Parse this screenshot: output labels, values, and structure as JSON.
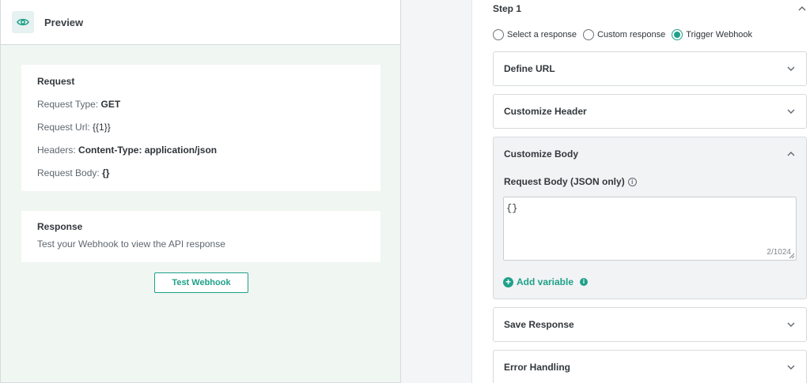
{
  "preview": {
    "title": "Preview",
    "request": {
      "heading": "Request",
      "type_label": "Request Type: ",
      "type_value": "GET",
      "url_label": "Request Url: ",
      "url_value": "{{1}}",
      "headers_label": "Headers: ",
      "headers_value": "Content-Type: application/json",
      "body_label": "Request Body: ",
      "body_value": "{}"
    },
    "response": {
      "heading": "Response",
      "text": "Test your Webhook to view the API response"
    },
    "test_button": "Test Webhook"
  },
  "config": {
    "step_label": "Step 1",
    "radios": [
      {
        "label": "Select a response",
        "checked": false
      },
      {
        "label": "Custom response",
        "checked": false
      },
      {
        "label": "Trigger Webhook",
        "checked": true
      }
    ],
    "sections": {
      "define_url": "Define URL",
      "customize_header": "Customize Header",
      "customize_body": "Customize Body",
      "save_response": "Save Response",
      "error_handling": "Error Handling"
    },
    "body": {
      "label": "Request Body (JSON only)",
      "value": "{}",
      "counter": "2/1024",
      "add_variable": "Add variable"
    }
  },
  "colors": {
    "accent": "#1fa189",
    "panel_bg": "#f0f6f1",
    "border": "#d6dadd"
  },
  "icons": [
    "eye-icon",
    "chevron-up-icon",
    "chevron-down-icon",
    "info-icon",
    "plus-circle-icon",
    "resize-grip-icon"
  ]
}
